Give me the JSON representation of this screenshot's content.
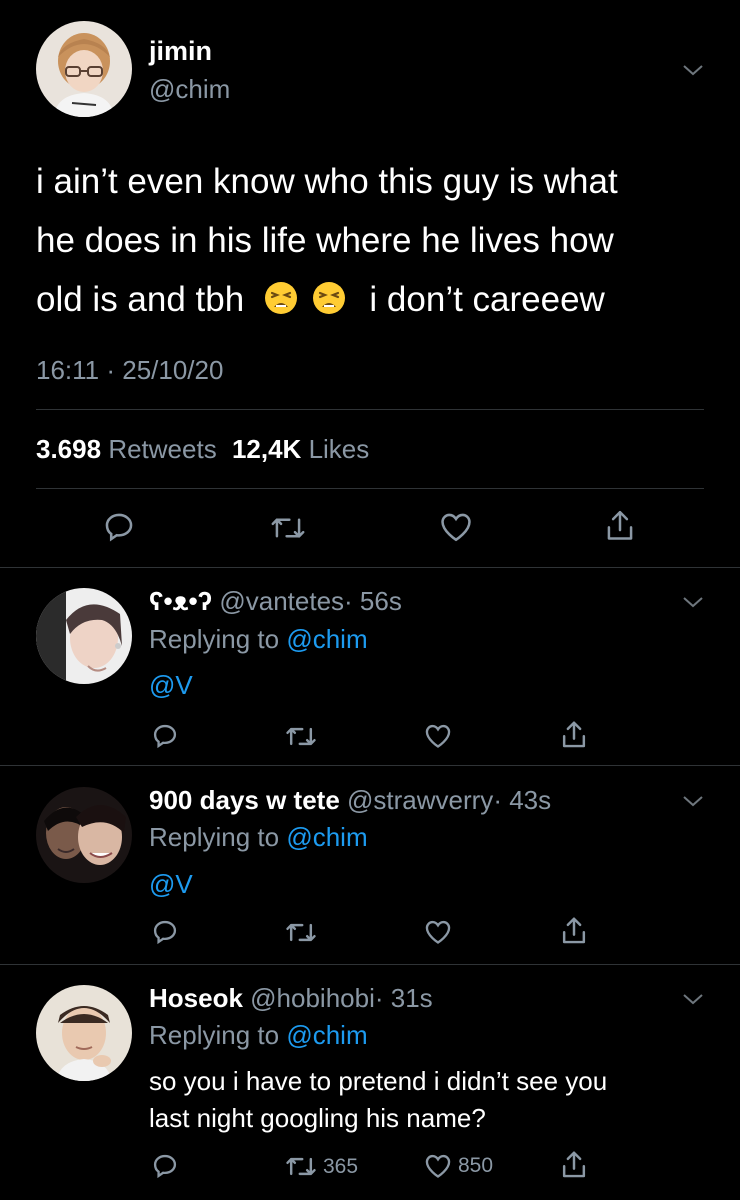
{
  "main_tweet": {
    "display_name": "jimin",
    "handle": "@chim",
    "text_line1": "i ain’t even know who this guy is what",
    "text_line2": "he does in his life where he lives how",
    "text_line3_a": "old is and tbh",
    "text_line3_b": "i don’t careeew",
    "emoji": [
      "tired-face",
      "tired-face"
    ],
    "timestamp": "16:11 · 25/10/20",
    "retweets_count": "3.698",
    "retweets_label": "Retweets",
    "likes_count": "12,4K",
    "likes_label": "Likes"
  },
  "replies": [
    {
      "display_name": "ʕ•ᴥ•ʔ",
      "handle": "@vantetes",
      "time": "· 56s",
      "replying_prefix": "Replying to",
      "replying_to": "@chim",
      "body": "@V",
      "retweets": "",
      "likes": ""
    },
    {
      "display_name": "900 days w tete",
      "handle": "@strawverry",
      "time": "· 43s",
      "replying_prefix": "Replying to",
      "replying_to": "@chim",
      "body": "@V",
      "retweets": "",
      "likes": ""
    },
    {
      "display_name": "Hoseok",
      "handle": "@hobihobi",
      "time": "· 31s",
      "replying_prefix": "Replying to",
      "replying_to": "@chim",
      "body_line1": "so you i have to pretend i didn’t see you",
      "body_line2": "last night googling his name?",
      "retweets": "365",
      "likes": "850"
    }
  ],
  "colors": {
    "background": "#000000",
    "text": "#ffffff",
    "secondary": "#8b98a5",
    "link": "#1d9bf0",
    "divider": "#2f3336"
  },
  "icons": [
    "chevron-down-icon",
    "reply-icon",
    "retweet-icon",
    "like-icon",
    "share-icon"
  ]
}
